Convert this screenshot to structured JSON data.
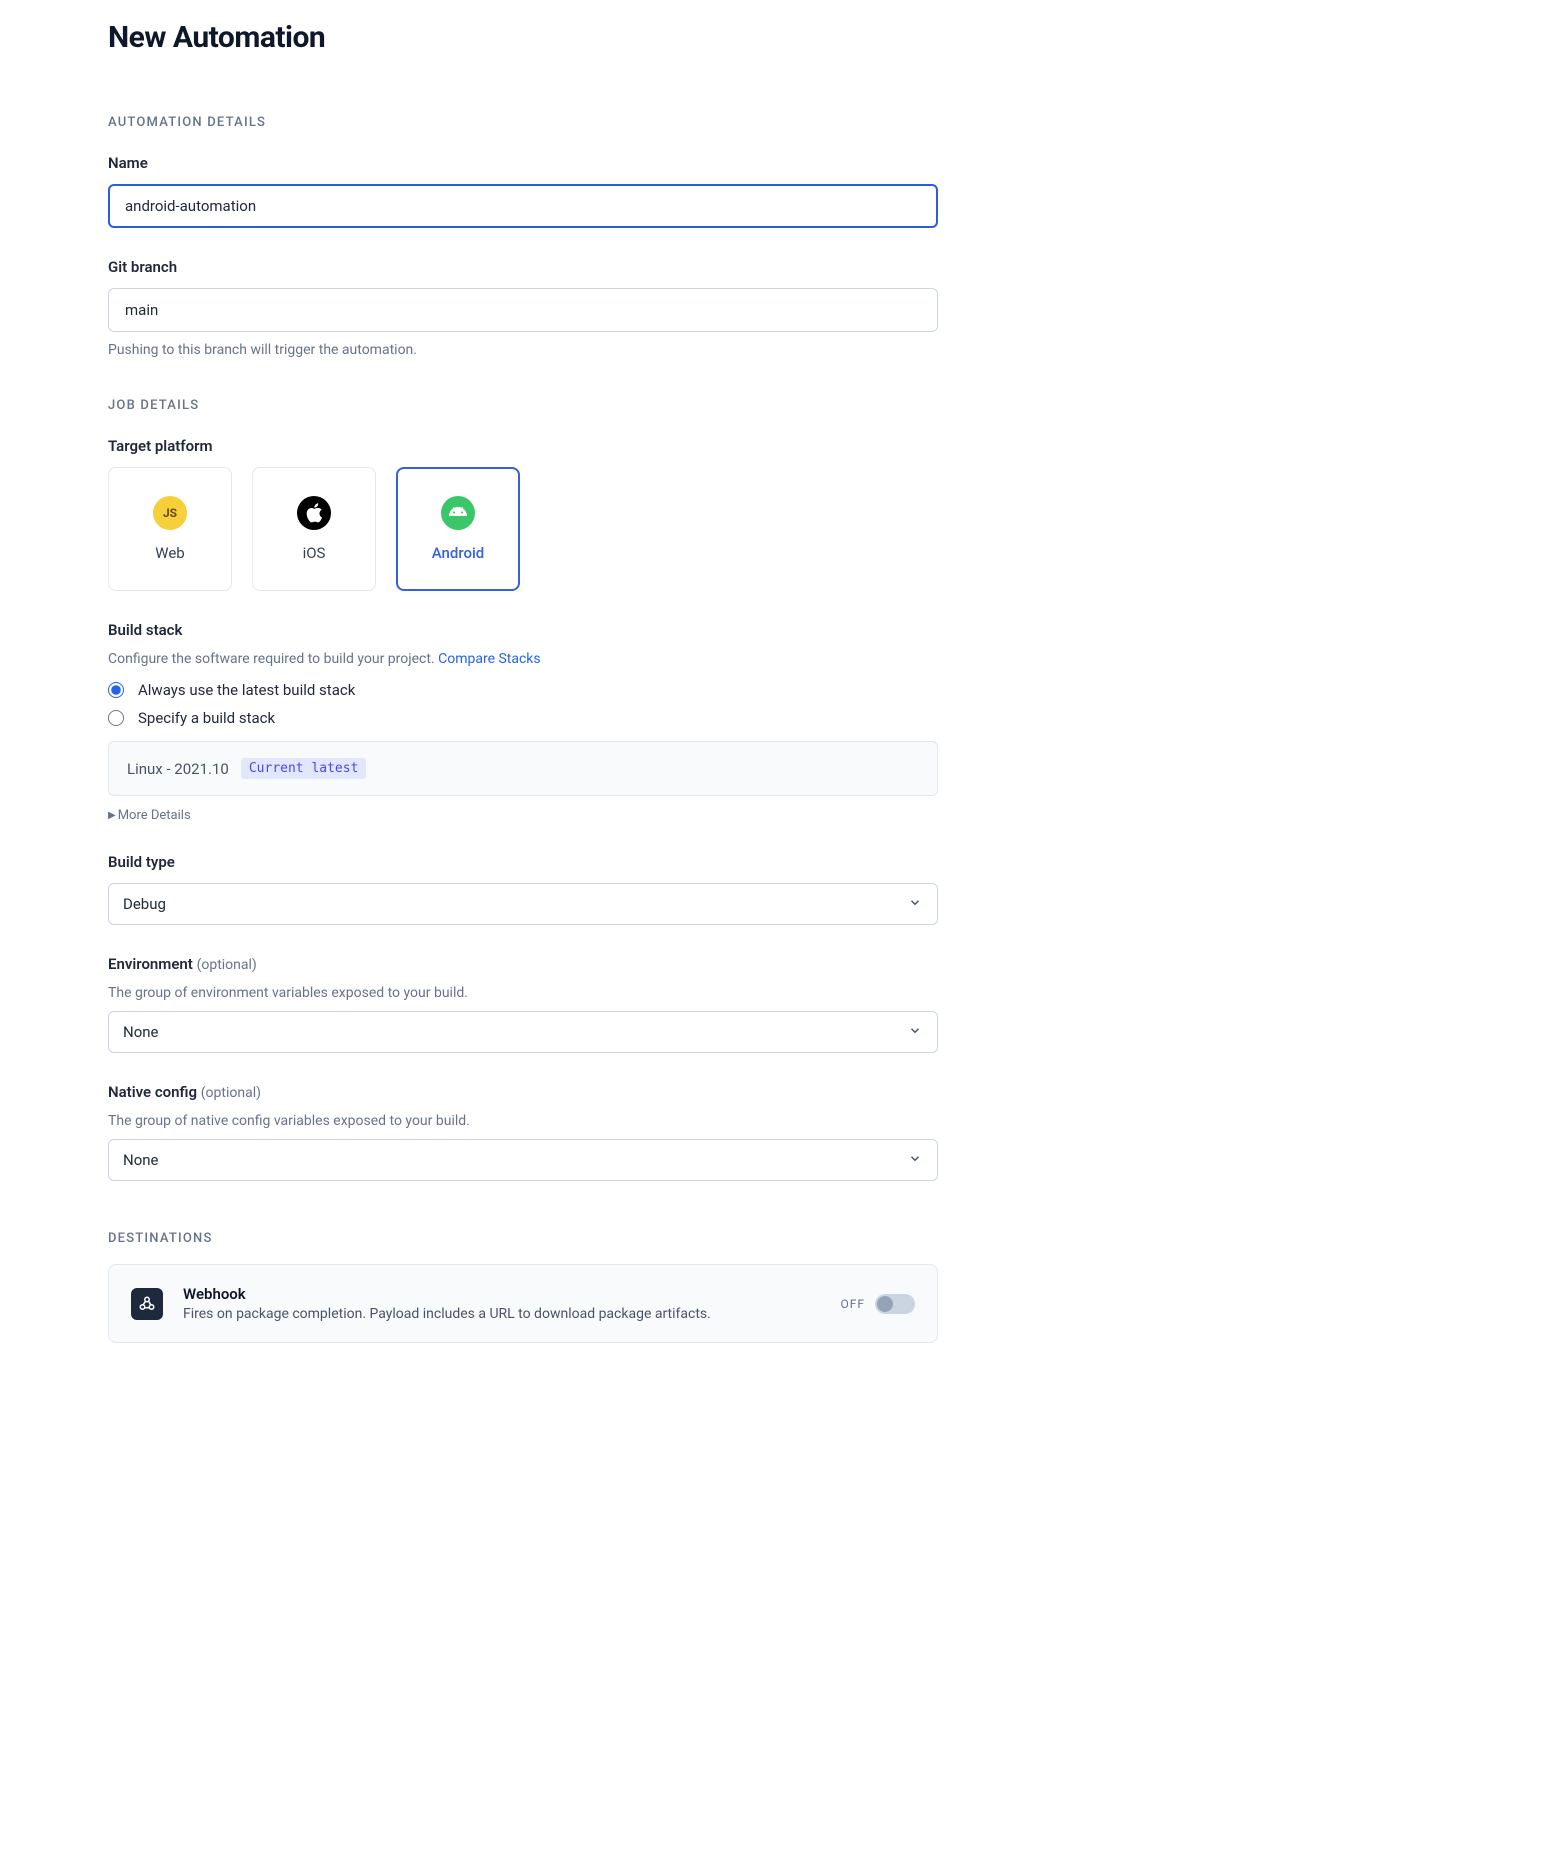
{
  "page": {
    "title": "New Automation"
  },
  "sections": {
    "details": "AUTOMATION DETAILS",
    "job": "JOB DETAILS",
    "destinations": "DESTINATIONS"
  },
  "name": {
    "label": "Name",
    "value": "android-automation"
  },
  "branch": {
    "label": "Git branch",
    "value": "main",
    "helper": "Pushing to this branch will trigger the automation."
  },
  "platform": {
    "label": "Target platform",
    "options": {
      "web": "Web",
      "ios": "iOS",
      "android": "Android"
    },
    "selected": "android"
  },
  "buildStack": {
    "label": "Build stack",
    "helper": "Configure the software required to build your project.",
    "compareLink": "Compare Stacks",
    "radios": {
      "latest": "Always use the latest build stack",
      "specify": "Specify a build stack"
    },
    "selectedRadio": "latest",
    "stackName": "Linux - 2021.10",
    "badge": "Current latest",
    "moreDetails": "More Details"
  },
  "buildType": {
    "label": "Build type",
    "value": "Debug"
  },
  "environment": {
    "label": "Environment",
    "optional": "(optional)",
    "helper": "The group of environment variables exposed to your build.",
    "value": "None"
  },
  "nativeConfig": {
    "label": "Native config",
    "optional": "(optional)",
    "helper": "The group of native config variables exposed to your build.",
    "value": "None"
  },
  "webhook": {
    "title": "Webhook",
    "desc": "Fires on package completion. Payload includes a URL to download package artifacts.",
    "state": "OFF"
  },
  "icons": {
    "web": "JS"
  }
}
